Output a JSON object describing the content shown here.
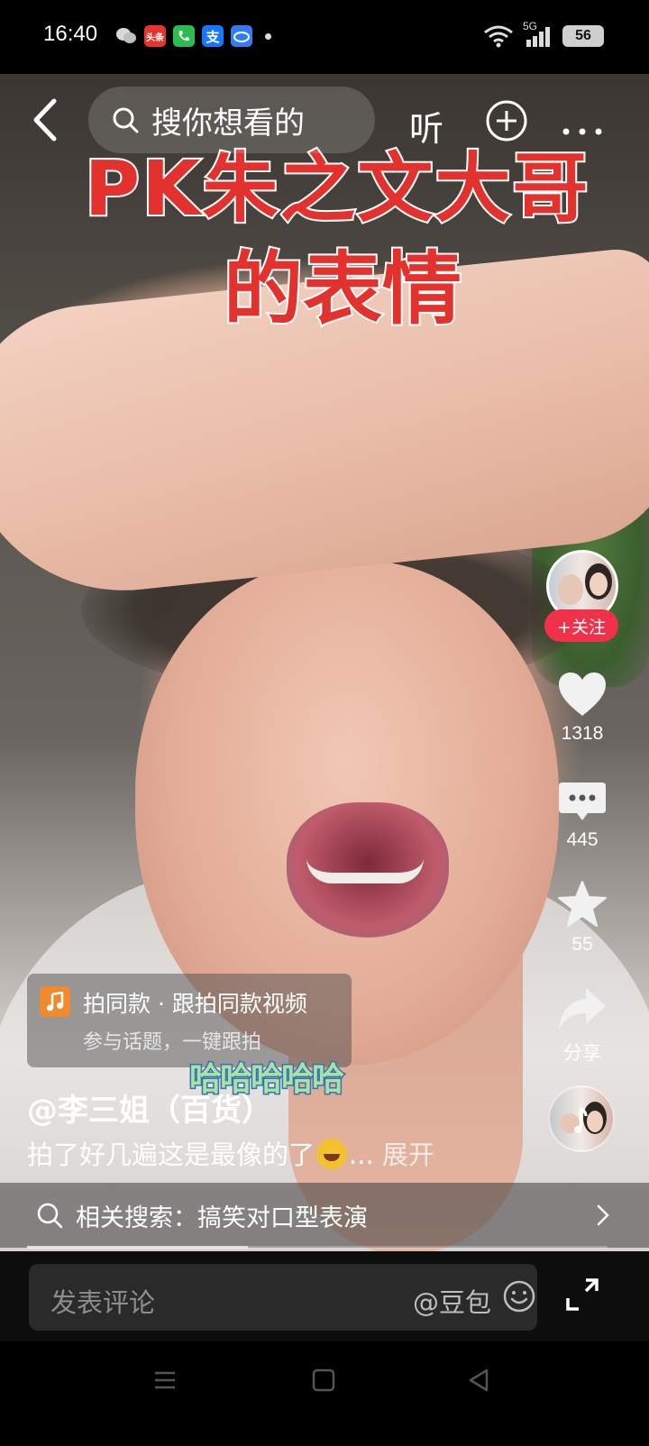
{
  "status_bar": {
    "time": "16:40",
    "apps": [
      {
        "icon": "wechat-icon",
        "color": "#d9d9d9",
        "label": ""
      },
      {
        "icon": "toutiao-icon",
        "color": "#e5352c",
        "label": "头条"
      },
      {
        "icon": "phone-icon",
        "color": "#2bbd4f",
        "label": ""
      },
      {
        "icon": "alipay-icon",
        "color": "#1677ff",
        "label": "支"
      },
      {
        "icon": "baidu-netdisk-icon",
        "color": "#2f7cf6",
        "label": ""
      }
    ],
    "network": "5G",
    "battery": "56"
  },
  "top_bar": {
    "search_placeholder": "搜你想看的",
    "listen_label": "听"
  },
  "video": {
    "caption_line1": "PK朱之文大哥",
    "caption_line2": "的表情",
    "sticker_text": "哈哈哈哈哈"
  },
  "right_rail": {
    "follow_label": "+关注",
    "like_count": "1318",
    "comment_count": "445",
    "favorite_count": "55",
    "share_label": "分享"
  },
  "same_style": {
    "title": "拍同款 · 跟拍同款视频",
    "subtitle": "参与话题，一键跟拍"
  },
  "post": {
    "author": "@李三姐（百货）",
    "description": "拍了好几遍这是最像的了",
    "ellipsis": "...",
    "expand_label": "展开"
  },
  "related_search": {
    "text": "相关搜索：搞笑对口型表演"
  },
  "playback": {
    "progress": 0.38
  },
  "comment_bar": {
    "placeholder": "发表评论",
    "mention_label": "@豆包"
  },
  "colors": {
    "caption_red": "#e3322e",
    "follow_red": "#f1304a",
    "music_orange": "#f08a2c"
  }
}
